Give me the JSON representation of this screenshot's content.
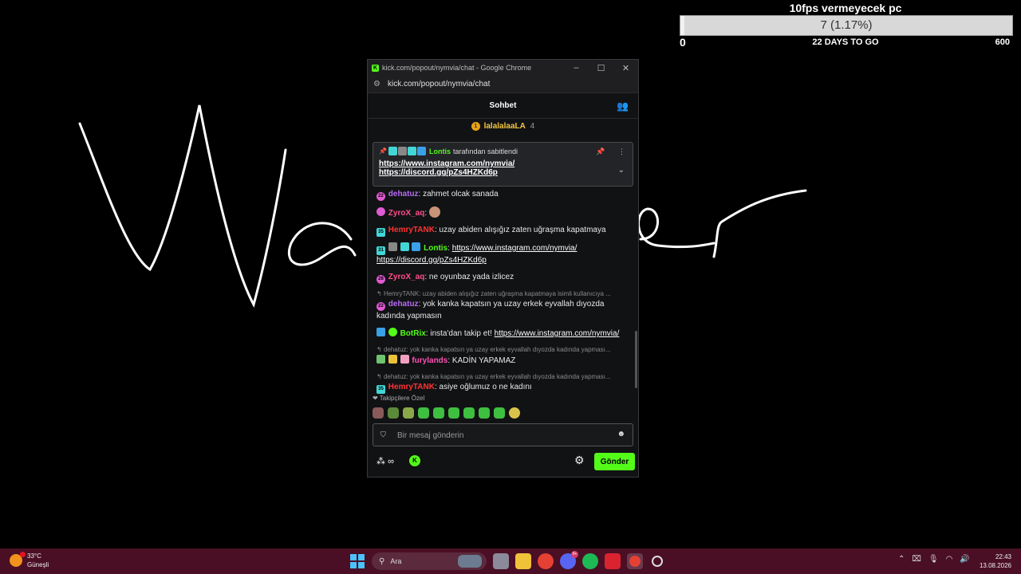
{
  "goal": {
    "title": "10fps vermeyecek pc",
    "progress_text": "7 (1.17%)",
    "progress_fraction": 0.0117,
    "min": "0",
    "days_left": "22 DAYS TO GO",
    "max": "600"
  },
  "window": {
    "title": "kick.com/popout/nymvia/chat - Google Chrome",
    "url": "kick.com/popout/nymvia/chat",
    "minimize": "–",
    "maximize": "☐",
    "close": "✕"
  },
  "chat": {
    "header_title": "Sohbet",
    "gift": {
      "rank": "1",
      "name": "lalalalaaLA",
      "count": "4"
    },
    "pinned": {
      "author": "Lontis",
      "suffix": "tarafından sabitlendi",
      "link1": "https://www.instagram.com/nymvia/",
      "link2": "https://discord.gg/pZs4HZKd6p"
    },
    "messages": [
      {
        "user": "dehatuz",
        "text": "zahmet olcak sanada"
      },
      {
        "user": "ZyroX_aq",
        "text": ""
      },
      {
        "user": "HemryTANK",
        "text": "uzay abiden alışığız zaten uğraşma kapatmaya"
      },
      {
        "user": "Lontis",
        "link1": "https://www.instagram.com/nymvia/",
        "link2": "https://discord.gg/pZs4HZKd6p"
      },
      {
        "user": "ZyroX_aq",
        "text": "ne oyunbaz yada izlicez"
      },
      {
        "reply": "HemryTANK: uzay abiden alışığız zaten uğraşma kapatmaya isimli kullanıcıya ...",
        "user": "dehatuz",
        "text": "yok kanka kapatsın ya uzay erkek eyvallah dıyozda kadında yapmasın"
      },
      {
        "user": "BotRix",
        "text": "insta'dan takip et!",
        "link": "https://www.instagram.com/nymvia/"
      },
      {
        "reply": "dehatuz: yok kanka kapatsın ya uzay erkek eyvallah dıyozda kadında yapması...",
        "user": "furylands",
        "text": "KADİN YAPAMAZ"
      },
      {
        "reply": "dehatuz: yok kanka kapatsın ya uzay erkek eyvallah dıyozda kadında yapması...",
        "user": "HemryTANK",
        "text": "asiye oğlumuz o ne kadını"
      }
    ],
    "emotes_title": "❤ Takipçilere Özel",
    "input_placeholder": "Bir mesaj gönderin",
    "send_label": "Gönder",
    "infinity": "∞"
  },
  "badges": {
    "m0": "22",
    "m2": "35",
    "m3": "31",
    "m4": "28",
    "m5": "22",
    "m8": "35"
  },
  "taskbar": {
    "temp": "33°C",
    "condition": "Güneşli",
    "search": "Ara",
    "discord_badge": "9+",
    "time": "22:43",
    "date": "13.08.2026"
  },
  "colors": {
    "kick_green": "#53fc18",
    "taskbar": "#4a0f25"
  }
}
